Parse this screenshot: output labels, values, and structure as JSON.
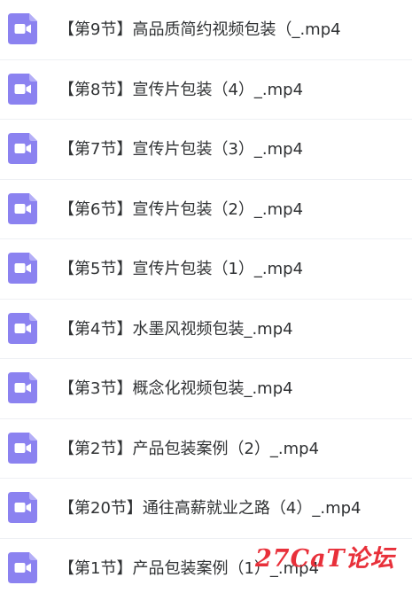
{
  "colors": {
    "icon_bg": "#8b82f0",
    "icon_fg": "#ffffff",
    "text": "#2f3133",
    "divider": "#eef0f4",
    "watermark": "#e8303a"
  },
  "files": [
    {
      "name": "【第9节】高品质简约视频包装（_.mp4",
      "icon": "video-file-icon"
    },
    {
      "name": "【第8节】宣传片包装（4）_.mp4",
      "icon": "video-file-icon"
    },
    {
      "name": "【第7节】宣传片包装（3）_.mp4",
      "icon": "video-file-icon"
    },
    {
      "name": "【第6节】宣传片包装（2）_.mp4",
      "icon": "video-file-icon"
    },
    {
      "name": "【第5节】宣传片包装（1）_.mp4",
      "icon": "video-file-icon"
    },
    {
      "name": "【第4节】水墨风视频包装_.mp4",
      "icon": "video-file-icon"
    },
    {
      "name": "【第3节】概念化视频包装_.mp4",
      "icon": "video-file-icon"
    },
    {
      "name": "【第2节】产品包装案例（2）_.mp4",
      "icon": "video-file-icon"
    },
    {
      "name": "【第20节】通往高薪就业之路（4）_.mp4",
      "icon": "video-file-icon"
    },
    {
      "name": "【第1节】产品包装案例（1）_.mp4",
      "icon": "video-file-icon"
    }
  ],
  "watermark": {
    "text": "27CaT论坛"
  }
}
